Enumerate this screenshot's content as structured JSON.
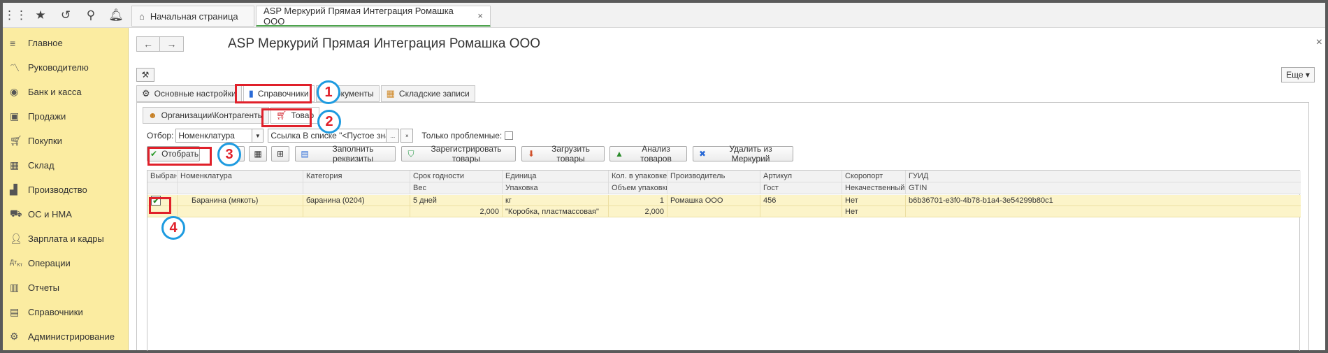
{
  "topbar": {
    "quick_icons": [
      "apps-grid-icon",
      "star-icon",
      "history-icon",
      "search-icon",
      "bell-icon"
    ],
    "tabs": [
      {
        "label": "Начальная страница",
        "icon": "home-icon"
      },
      {
        "label": "ASP Меркурий Прямая Интеграция Ромашка ООО",
        "close": "×"
      }
    ]
  },
  "sidebar": {
    "items": [
      {
        "label": "Главное",
        "icon": "menu-lines-icon"
      },
      {
        "label": "Руководителю",
        "icon": "chart-line-icon"
      },
      {
        "label": "Банк и касса",
        "icon": "coin-icon"
      },
      {
        "label": "Продажи",
        "icon": "bag-icon"
      },
      {
        "label": "Покупки",
        "icon": "cart-icon"
      },
      {
        "label": "Склад",
        "icon": "warehouse-icon"
      },
      {
        "label": "Производство",
        "icon": "factory-icon"
      },
      {
        "label": "ОС и НМА",
        "icon": "truck-icon"
      },
      {
        "label": "Зарплата и кадры",
        "icon": "person-icon"
      },
      {
        "label": "Операции",
        "icon": "dt-kt-icon"
      },
      {
        "label": "Отчеты",
        "icon": "bar-chart-icon"
      },
      {
        "label": "Справочники",
        "icon": "books-icon"
      },
      {
        "label": "Администрирование",
        "icon": "gear-icon"
      }
    ]
  },
  "window": {
    "title": "ASP Меркурий Прямая Интеграция Ромашка ООО",
    "back": "←",
    "forward": "→",
    "close": "×",
    "more_button": "Еще ▾"
  },
  "main_tabs": [
    {
      "label": "Основные настройки",
      "icon": "gear-icon"
    },
    {
      "label": "Справочники",
      "icon": "book-icon",
      "selected": true
    },
    {
      "label": "Документы",
      "icon": "document-icon"
    },
    {
      "label": "Складские записи",
      "icon": "boxes-icon"
    }
  ],
  "sub_tabs": [
    {
      "label": "Организации\\Контрагенты",
      "icon": "people-icon"
    },
    {
      "label": "Товар",
      "icon": "cart-icon",
      "selected": true
    }
  ],
  "filter": {
    "label": "Отбор:",
    "value": "Номенклатура",
    "condition": "Ссылка В списке \"<Пустое значение>; ...",
    "dots": "...",
    "clear": "×",
    "only_problem_label": "Только проблемные:"
  },
  "toolbar": {
    "select_label": "Отобрать",
    "fill_label": "Заполнить реквизиты",
    "register_label": "Зарегистрировать товары",
    "load_label": "Загрузить товары",
    "analyze_label": "Анализ товаров",
    "delete_label": "Удалить из Меркурий"
  },
  "table": {
    "header_top": [
      "Выбран",
      "Номенклатура",
      "Категория",
      "Срок годности",
      "Единица",
      "Кол. в упаковке",
      "Производитель",
      "Артикул",
      "Скоропорт",
      "ГУИД"
    ],
    "header_bottom": [
      "",
      "",
      "",
      "Вес",
      "Упаковка",
      "Объем упаковки",
      "",
      "Гост",
      "Некачественный",
      "GTIN"
    ],
    "row_top": [
      "",
      "Баранина (мякоть)",
      "баранина (0204)",
      "5 дней",
      "кг",
      "1",
      "Ромашка ООО",
      "456",
      "Нет",
      "b6b36701-e3f0-4b78-b1a4-3e54299b80c1"
    ],
    "row_bottom": [
      "",
      "",
      "",
      "2,000",
      "\"Коробка, пластмассовая\"",
      "2,000",
      "",
      "",
      "Нет",
      ""
    ],
    "checked": true
  },
  "annotations": [
    "1",
    "2",
    "3",
    "4"
  ],
  "colors": {
    "sidebar_bg": "#fbeca1",
    "row_highlight": "#fcf4c9",
    "annotation_red": "#e0202a",
    "annotation_blue": "#1e9be0"
  }
}
